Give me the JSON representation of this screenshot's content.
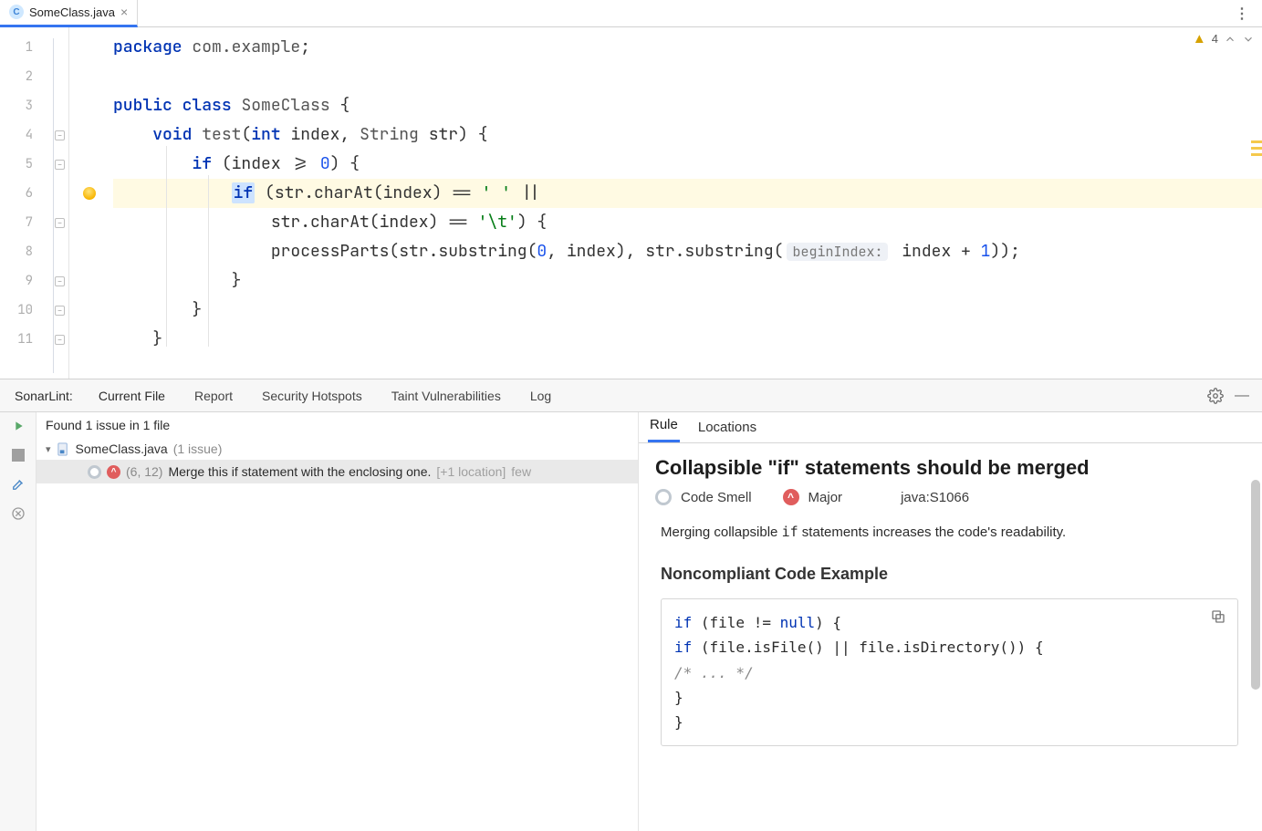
{
  "tab": {
    "file_name": "SomeClass.java"
  },
  "editor": {
    "warnings_count": "4",
    "lines": {
      "l1": {
        "kw1": "package",
        "pkg": "com.example",
        "tail": ";"
      },
      "l3": {
        "kw1": "public",
        "kw2": "class",
        "name": "SomeClass",
        "tail": " {"
      },
      "l4": {
        "kw1": "void",
        "name": "test",
        "p1_kw": "int",
        "p1": "index",
        "p2_kw": "String",
        "p2": "str",
        "tail": ") {"
      },
      "l5": {
        "kw": "if",
        "rest": " (index >= ",
        "num": "0",
        "tail": ") {"
      },
      "l6": {
        "kw": "if",
        "rest": " (str.charAt(index) == ",
        "s": "' '",
        "tail": " ||"
      },
      "l7": {
        "rest": "str.charAt(index) == ",
        "s": "'\\t'",
        "tail": ") {"
      },
      "l8": {
        "head": "processParts(str.substring(",
        "n1": "0",
        "mid": ", index), str.substring(",
        "hint": "beginIndex:",
        "rest": " index + ",
        "n2": "1",
        "tail": "));"
      },
      "l9": {
        "t": "}"
      },
      "l10": {
        "t": "}"
      },
      "l11": {
        "t": "}"
      }
    }
  },
  "sonar": {
    "panel_label": "SonarLint:",
    "tabs": {
      "current": "Current File",
      "report": "Report",
      "hotspots": "Security Hotspots",
      "taint": "Taint Vulnerabilities",
      "log": "Log"
    },
    "issues": {
      "summary": "Found 1 issue in 1 file",
      "file": "SomeClass.java",
      "file_meta": "(1 issue)",
      "issue": {
        "location": "(6, 12)",
        "message": "Merge this if statement with the enclosing one.",
        "extra": "[+1 location]",
        "age": "few"
      }
    },
    "detail_tabs": {
      "rule": "Rule",
      "locations": "Locations"
    },
    "rule": {
      "title": "Collapsible \"if\" statements should be merged",
      "type": "Code Smell",
      "severity": "Major",
      "key": "java:S1066",
      "desc_pre": "Merging collapsible ",
      "desc_code": "if",
      "desc_post": " statements increases the code's readability.",
      "section_noncompliant": "Noncompliant Code Example",
      "example": {
        "l1_kw": "if",
        "l1_rest": " (file != ",
        "l1_null": "null",
        "l1_tail": ") {",
        "l2_kw": "if",
        "l2_rest": " (file.isFile() || file.isDirectory()) {",
        "l3_cm": "/* ... */",
        "l4": "}",
        "l5": "}"
      }
    }
  }
}
